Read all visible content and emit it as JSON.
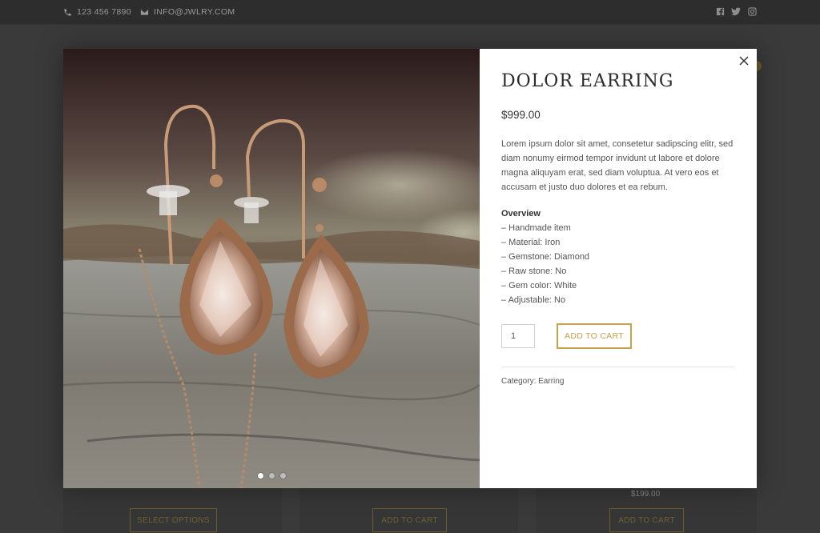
{
  "topbar": {
    "phone": "123 456 7890",
    "email": "INFO@JWLRY.COM",
    "social": [
      "facebook-icon",
      "twitter-icon",
      "instagram-icon"
    ]
  },
  "background": {
    "buttons": [
      "SELECT OPTIONS",
      "ADD TO CART",
      "ADD TO CART"
    ],
    "price": "$199.00"
  },
  "modal": {
    "title": "DOLOR EARRING",
    "price": "$999.00",
    "description": "Lorem ipsum dolor sit amet, consetetur sadipscing elitr, sed diam nonumy eirmod tempor invidunt ut labore et dolore magna aliquyam erat, sed diam voluptua. At vero eos et accusam et justo duo dolores et ea rebum.",
    "overview_title": "Overview",
    "overview_items": [
      "– Handmade item",
      "– Material: Iron",
      "– Gemstone: Diamond",
      "– Raw stone: No",
      "– Gem color: White",
      "– Adjustable: No"
    ],
    "quantity": "1",
    "add_to_cart_label": "ADD TO CART",
    "category_label": "Category:",
    "category_value": "Earring",
    "gallery_slide_count": 3,
    "gallery_active_slide": 1
  },
  "colors": {
    "accent": "#c9a04b",
    "overlay": "#3a3a3a",
    "panel": "#ffffff"
  }
}
